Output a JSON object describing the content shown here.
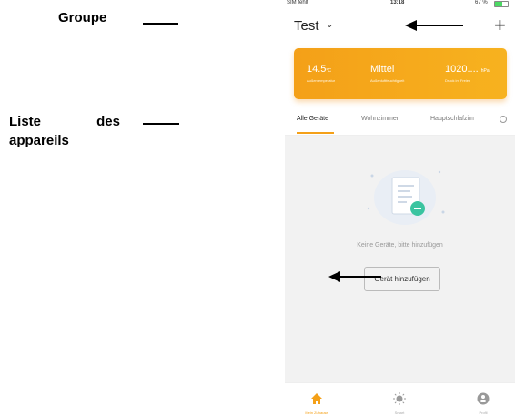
{
  "annotations": {
    "group_label": "Groupe",
    "device_list_label": "Liste des appareils"
  },
  "status_bar": {
    "carrier": "SIM fehlt",
    "time": "13:18",
    "battery": "67 %",
    "battery_level": 0.67
  },
  "header": {
    "title": "Test",
    "add_icon": "plus-icon",
    "dropdown_icon": "chevron-down-icon"
  },
  "weather": {
    "temperature": "14.5",
    "temperature_unit": "°C",
    "temperature_label": "Außentemperatur",
    "humidity": "Mittel",
    "humidity_label": "Außenluftfeuchtigkeit",
    "pressure": "1020....",
    "pressure_unit": "hPa",
    "pressure_label": "Druck im Freien"
  },
  "tabs": [
    {
      "label": "Alle Geräte",
      "active": true
    },
    {
      "label": "Wohnzimmer",
      "active": false
    },
    {
      "label": "Hauptschlafzim",
      "active": false
    }
  ],
  "empty_state": {
    "message": "Keine Geräte, bitte hinzufügen",
    "add_button": "Gerät hinzufügen"
  },
  "tabbar": [
    {
      "label": "Mein Zuhause",
      "icon": "home-icon",
      "active": true
    },
    {
      "label": "Smart",
      "icon": "smart-sun-icon",
      "active": false
    },
    {
      "label": "Profil",
      "icon": "profile-icon",
      "active": false
    }
  ],
  "colors": {
    "accent": "#f4a018",
    "background": "#f2f2f2"
  }
}
